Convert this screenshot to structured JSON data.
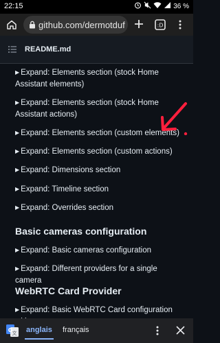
{
  "status": {
    "time": "22:15",
    "battery": "36 %"
  },
  "browser": {
    "url": "github.com/dermotduf"
  },
  "file": {
    "title": "README.md"
  },
  "items": [
    {
      "label": "Expand: Elements section (stock Home Assistant elements)"
    },
    {
      "label": "Expand: Elements section (stock Home Assistant actions)"
    },
    {
      "label": "Expand: Elements section (custom elements)"
    },
    {
      "label": "Expand: Elements section (custom actions)"
    },
    {
      "label": "Expand: Dimensions section"
    },
    {
      "label": "Expand: Timeline section"
    },
    {
      "label": "Expand: Overrides section"
    }
  ],
  "section1": {
    "heading": "Basic cameras configuration",
    "items": [
      {
        "label": "Expand: Basic cameras configuration"
      },
      {
        "label": "Expand: Different providers for a single camera"
      }
    ]
  },
  "section2": {
    "heading": "WebRTC Card Provider",
    "items": [
      {
        "label": "Expand: Basic WebRTC Card configuration with"
      }
    ]
  },
  "translate": {
    "source_lang": "anglais",
    "target_lang": "français"
  },
  "annotation": {
    "color": "#ff1f3d"
  }
}
